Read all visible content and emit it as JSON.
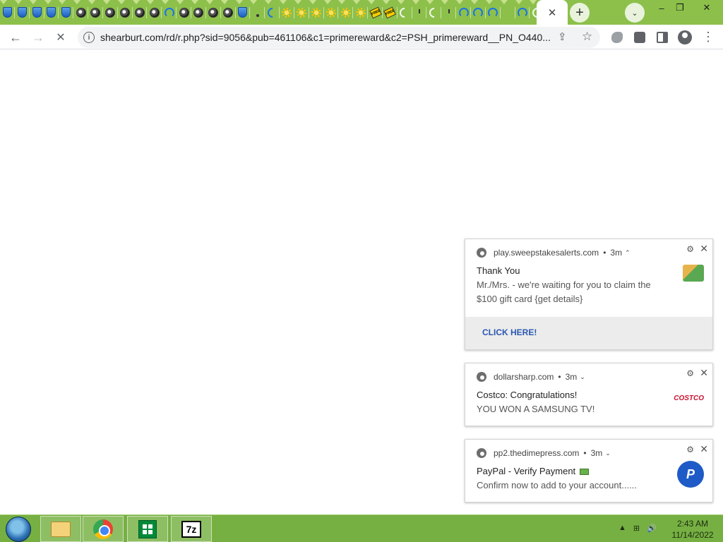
{
  "browser": {
    "tabs": [
      "shield",
      "shield",
      "shield",
      "shield",
      "shield",
      "globe",
      "globe",
      "globe",
      "globe",
      "globe",
      "globe",
      "spin2",
      "globe",
      "globe",
      "globe",
      "globe",
      "shield",
      "dot",
      "spin",
      "sun",
      "sun",
      "sun",
      "sun",
      "sun",
      "sun",
      "tag",
      "tag",
      "arc",
      "tick",
      "arc",
      "tick",
      "spin2",
      "spin2",
      "spin2",
      "none",
      "spin2",
      "arc"
    ],
    "active_tab_close": "✕",
    "new_tab": "+",
    "tab_search": "⌄",
    "window": {
      "minimize": "–",
      "maximize": "❐",
      "close": "✕"
    },
    "toolbar": {
      "back": "←",
      "forward": "→",
      "stop": "✕",
      "info": "i",
      "url": "shearburt.com/rd/r.php?sid=9056&pub=461106&c1=primereward&c2=PSH_primereward__PN_O440...",
      "share": "⇪",
      "star": "☆",
      "menu": "⋮"
    }
  },
  "notifications": [
    {
      "source": "play.sweepstakesalerts.com",
      "time": "3m",
      "caret": "⌃",
      "title": "Thank You",
      "body": "Mr./Mrs.  - we're waiting for you to claim the $100 gift card {get details}",
      "action": "CLICK HERE!",
      "icon": "gift-card-icon"
    },
    {
      "source": "dollarsharp.com",
      "time": "3m",
      "caret": "⌄",
      "title": "Costco: Congratulations!",
      "body": "YOU WON A SAMSUNG TV!",
      "logo_text": "COSTCO",
      "icon": "costco-logo"
    },
    {
      "source": "pp2.thedimepress.com",
      "time": "3m",
      "caret": "⌄",
      "title": "PayPal - Verify Payment",
      "body": "Confirm now to add to your account......",
      "logo_text": "P",
      "icon": "paypal-logo"
    }
  ],
  "notification_controls": {
    "settings": "⚙",
    "close": "✕",
    "dot": "•"
  },
  "taskbar": {
    "items": [
      "file-explorer",
      "chrome",
      "store",
      "7zip"
    ],
    "seven_zip_label": "7z",
    "tray": {
      "chevron": "▲",
      "network": "⊞",
      "volume": "🔊"
    },
    "clock": {
      "time": "2:43 AM",
      "date": "11/14/2022"
    }
  },
  "colors": {
    "tabstrip": "#8cc04b",
    "taskbar": "#76b042",
    "link": "#2a57b0"
  }
}
